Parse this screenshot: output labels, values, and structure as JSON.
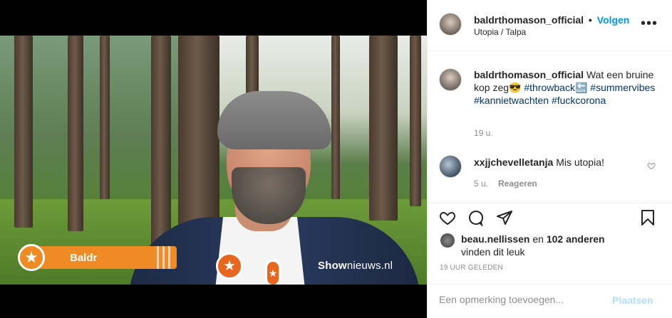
{
  "header": {
    "username": "baldrthomason_official",
    "separator": "•",
    "follow_label": "Volgen",
    "location": "Utopia / Talpa",
    "more_icon": "more-horizontal-icon"
  },
  "video": {
    "lower_third_name": "Baldr",
    "watermark_bold": "Show",
    "watermark_rest": "nieuws.nl"
  },
  "caption": {
    "username": "baldrthomason_official",
    "text_start": "Wat een bruine kop zeg",
    "emoji": "😎",
    "tag_throwback": "#throwback",
    "back_emoji": "🔙",
    "tag_summervibes": "#summervibes",
    "tag_kannietwachten": "#kannietwachten",
    "tag_fuckcorona": "#fuckcorona",
    "time": "19 u."
  },
  "comments": [
    {
      "username": "xxjjchevelletanja",
      "text": "Mis utopia!",
      "time": "5 u.",
      "reply_label": "Reageren"
    }
  ],
  "likes": {
    "user": "beau.nellissen",
    "and": "en",
    "others": "102 anderen",
    "line2": "vinden dit leuk"
  },
  "post_time": "19 UUR GELEDEN",
  "comment_input": {
    "placeholder": "Een opmerking toevoegen...",
    "post_label": "Plaatsen"
  },
  "colors": {
    "accent": "#0095f6",
    "hashtag": "#00376b",
    "secondary_text": "#8e8e8e",
    "post_disabled": "#b2dffc",
    "lower_third_orange": "#f08a24"
  }
}
